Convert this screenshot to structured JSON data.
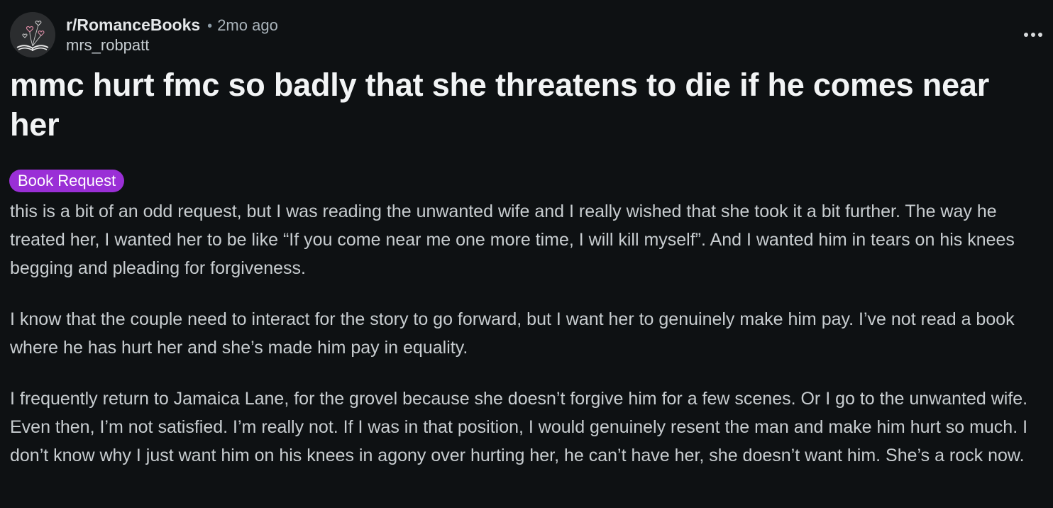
{
  "post": {
    "subreddit": "r/RomanceBooks",
    "separator": "•",
    "time_ago": "2mo ago",
    "author": "mrs_robpatt",
    "title": "mmc hurt fmc so badly that she threatens to die if he comes near her",
    "flair": "Book Request",
    "flair_color": "#9a2fd6",
    "more_icon": "ellipsis-icon",
    "avatar_icon": "open-book-hearts-icon",
    "paragraphs": [
      "this is a bit of an odd request, but I was reading the unwanted wife and I really wished that she took it a bit further. The way he treated her, I wanted her to be like “If you come near me one more time, I will kill myself”. And I wanted him in tears on his knees begging and pleading for forgiveness.",
      "I know that the couple need to interact for the story to go forward, but I want her to genuinely make him pay. I’ve not read a book where he has hurt her and she’s made him pay in equality.",
      "I frequently return to Jamaica Lane, for the grovel because she doesn’t forgive him for a few scenes. Or I go to the unwanted wife. Even then, I’m not satisfied. I’m really not. If I was in that position, I would genuinely resent the man and make him hurt so much. I don’t know why I just want him on his knees in agony over hurting her, he can’t have her, she doesn’t want him. She’s a rock now."
    ]
  },
  "colors": {
    "background": "#0e1113",
    "title_text": "#f2f4f5",
    "body_text": "#c8cdd0",
    "meta_text": "#aab4bb"
  }
}
